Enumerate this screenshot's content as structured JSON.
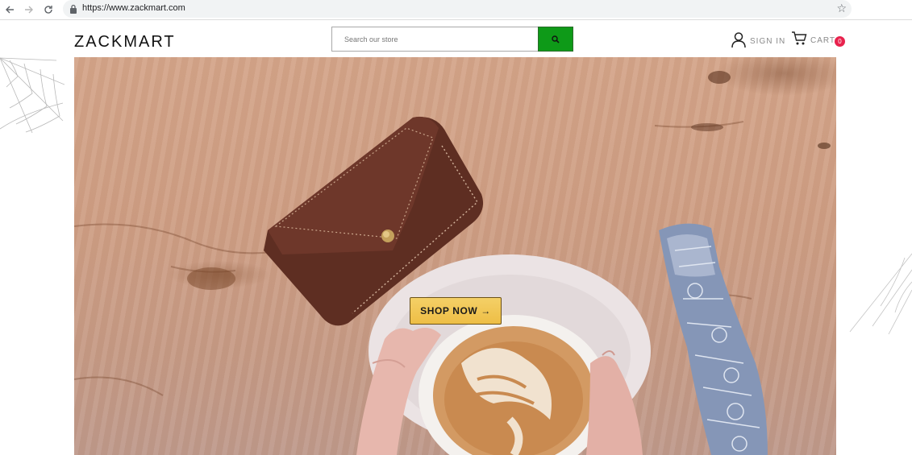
{
  "browser": {
    "back_icon": "arrow-left-icon",
    "forward_icon": "arrow-right-icon",
    "reload_icon": "reload-icon",
    "lock_icon": "lock-icon",
    "url": "https://www.zackmart.com",
    "bookmark_icon": "star-icon"
  },
  "header": {
    "logo": "ZACKMART",
    "search": {
      "placeholder": "Search our store",
      "value": "",
      "button_icon": "search-icon",
      "button_color": "#0e9a18"
    },
    "sign_in_label": "SIGN IN",
    "cart_label": "CART",
    "cart_count": "0",
    "cart_badge_color": "#e8224d"
  },
  "hero": {
    "shop_now_label": "SHOP NOW →",
    "shop_now_color": "#f1c350"
  }
}
